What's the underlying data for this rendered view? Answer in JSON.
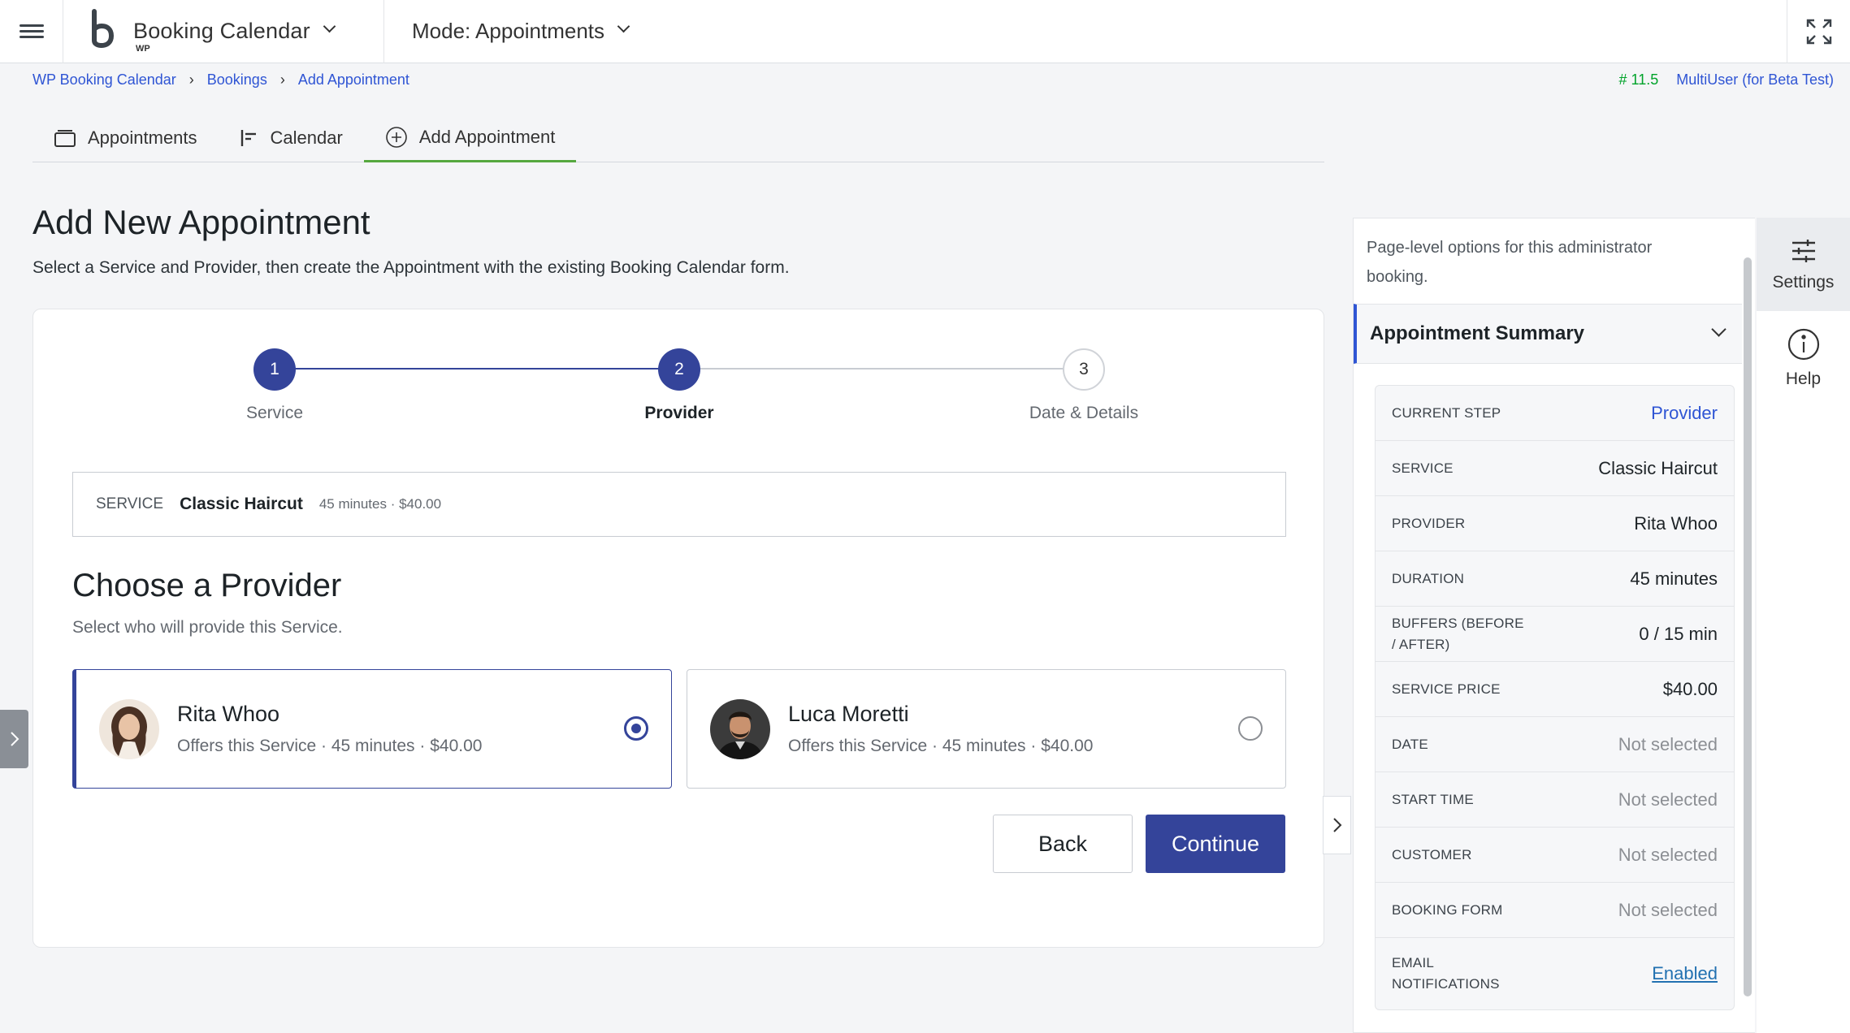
{
  "topbar": {
    "brand_title": "Booking Calendar",
    "brand_sub": "WP",
    "mode_label": "Mode: Appointments"
  },
  "breadcrumb": [
    "WP Booking Calendar",
    "Bookings",
    "Add Appointment"
  ],
  "version": {
    "number": "# 11.5",
    "edition": "MultiUser (for Beta Test)"
  },
  "tabs": [
    {
      "label": "Appointments",
      "icon": "tray-icon"
    },
    {
      "label": "Calendar",
      "icon": "timeline-icon"
    },
    {
      "label": "Add Appointment",
      "icon": "plus-circle-icon",
      "active": true
    }
  ],
  "page": {
    "title": "Add New Appointment",
    "description": "Select a Service and Provider, then create the Appointment with the existing Booking Calendar form."
  },
  "stepper": [
    {
      "num": "1",
      "label": "Service",
      "state": "done"
    },
    {
      "num": "2",
      "label": "Provider",
      "state": "current"
    },
    {
      "num": "3",
      "label": "Date & Details",
      "state": "todo"
    }
  ],
  "service_box": {
    "key": "SERVICE",
    "name": "Classic Haircut",
    "meta": "45 minutes · $40.00"
  },
  "provider_section": {
    "title": "Choose a Provider",
    "subtitle": "Select who will provide this Service.",
    "providers": [
      {
        "name": "Rita Whoo",
        "desc": "Offers this Service · 45 minutes · $40.00",
        "selected": true
      },
      {
        "name": "Luca Moretti",
        "desc": "Offers this Service · 45 minutes · $40.00",
        "selected": false
      }
    ]
  },
  "buttons": {
    "back": "Back",
    "continue": "Continue"
  },
  "panel": {
    "note": "Page-level options for this administrator booking.",
    "summary_title": "Appointment Summary",
    "rows": [
      {
        "key": "CURRENT STEP",
        "value": "Provider",
        "style": "link"
      },
      {
        "key": "SERVICE",
        "value": "Classic Haircut",
        "style": ""
      },
      {
        "key": "PROVIDER",
        "value": "Rita Whoo",
        "style": ""
      },
      {
        "key": "DURATION",
        "value": "45 minutes",
        "style": ""
      },
      {
        "key": "BUFFERS (BEFORE / AFTER)",
        "value": "0 / 15 min",
        "style": ""
      },
      {
        "key": "SERVICE PRICE",
        "value": "$40.00",
        "style": ""
      },
      {
        "key": "DATE",
        "value": "Not selected",
        "style": "muted"
      },
      {
        "key": "START TIME",
        "value": "Not selected",
        "style": "muted"
      },
      {
        "key": "CUSTOMER",
        "value": "Not selected",
        "style": "muted"
      },
      {
        "key": "BOOKING FORM",
        "value": "Not selected",
        "style": "muted"
      },
      {
        "key": "EMAIL NOTIFICATIONS",
        "value": "Enabled",
        "style": "und"
      }
    ]
  },
  "rail": [
    {
      "label": "Settings",
      "icon": "sliders-icon"
    },
    {
      "label": "Help",
      "icon": "info-icon"
    }
  ],
  "colors": {
    "primary": "#34449a",
    "link": "#2f55d4",
    "version_green": "#00a32a",
    "active_tab": "#56a83f"
  }
}
